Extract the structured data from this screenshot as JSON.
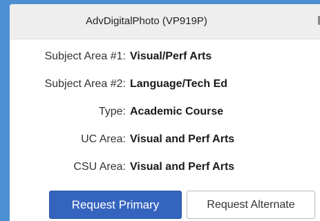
{
  "course": {
    "title": "AdvDigitalPhoto (VP919P)"
  },
  "details": [
    {
      "label": "Subject Area #1:",
      "value": "Visual/Perf Arts"
    },
    {
      "label": "Subject Area #2:",
      "value": "Language/Tech Ed"
    },
    {
      "label": "Type:",
      "value": "Academic Course"
    },
    {
      "label": "UC Area:",
      "value": "Visual and Perf Arts"
    },
    {
      "label": "CSU Area:",
      "value": "Visual and Perf Arts"
    }
  ],
  "actions": {
    "primary_label": "Request Primary",
    "alternate_label": "Request Alternate"
  },
  "colors": {
    "page_background": "#4d8fd3",
    "header_background": "#eeeeee",
    "primary_button": "#3564bf"
  }
}
